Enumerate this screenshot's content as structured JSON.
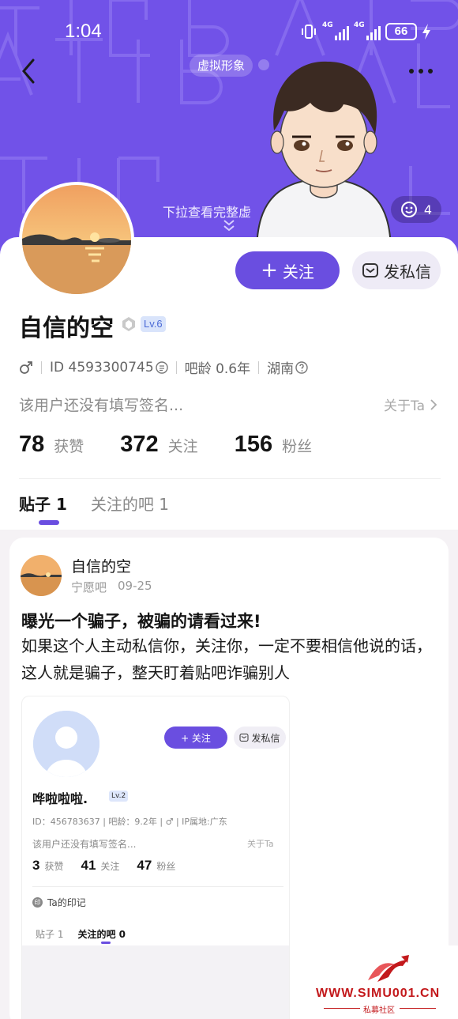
{
  "status_bar": {
    "time": "1:04",
    "network1": "4G",
    "network2": "4G",
    "battery": "66"
  },
  "header": {
    "avatar_tag": "虚拟形象",
    "pull_hint": "下拉查看完整虚",
    "mood_count": "4"
  },
  "profile": {
    "username": "自信的空",
    "level": "Lv.6",
    "id_text": "ID 4593300745",
    "bar_age": "吧龄 0.6年",
    "location": "湖南",
    "signature": "该用户还没有填写签名...",
    "about": "关于Ta",
    "follow_label": "关注",
    "message_label": "发私信",
    "stats": [
      {
        "num": "78",
        "label": "获赞"
      },
      {
        "num": "372",
        "label": "关注"
      },
      {
        "num": "156",
        "label": "粉丝"
      }
    ],
    "tabs": [
      {
        "label": "贴子 1"
      },
      {
        "label": "关注的吧 1"
      }
    ]
  },
  "post": {
    "author": "自信的空",
    "forum": "宁愿吧",
    "date": "09-25",
    "title": "曝光一个骗子，被骗的请看过来!",
    "body": "如果这个人主动私信你，关注你，一定不要相信他说的话，这人就是骗子，整天盯着贴吧诈骗别人"
  },
  "embed": {
    "follow_label": "+ 关注",
    "message_label": "发私信",
    "name": "哗啦啦啦.",
    "level": "Lv.2",
    "meta": "ID：456783637  |  吧龄：9.2年  |  ♂  |  IP属地:广东",
    "signature": "该用户还没有填写签名...",
    "about": "关于Ta",
    "stats": [
      {
        "num": "3",
        "label": "获赞"
      },
      {
        "num": "41",
        "label": "关注"
      },
      {
        "num": "47",
        "label": "粉丝"
      }
    ],
    "mark_label": "Ta的印记",
    "mark_icon": "印",
    "tabs": [
      {
        "label": "贴子 1"
      },
      {
        "label": "关注的吧 0"
      }
    ]
  },
  "watermark": {
    "text": "WWW.SIMU001.CN",
    "sub": "私募社区"
  },
  "colors": {
    "banner": "#7152e8",
    "accent": "#6a4ee0",
    "watermark": "#c3191c"
  }
}
